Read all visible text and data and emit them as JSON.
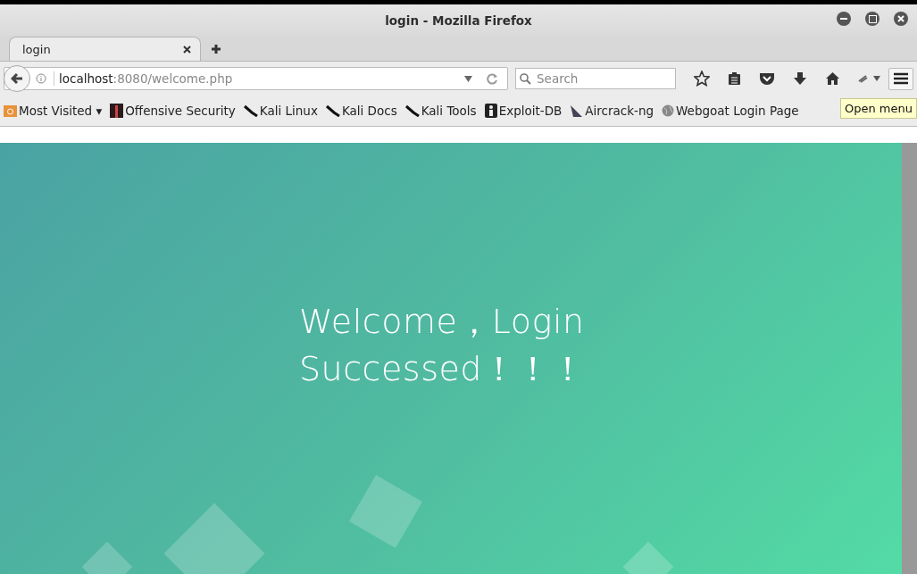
{
  "window": {
    "title": "login - Mozilla Firefox"
  },
  "tabs": [
    {
      "label": "login",
      "selected": true
    }
  ],
  "address_bar": {
    "host": "localhost",
    "path": ":8080/welcome.php"
  },
  "search": {
    "placeholder": "Search"
  },
  "bookmarks": [
    {
      "label": "Most Visited ▾",
      "kind": "folder"
    },
    {
      "label": "Offensive Security",
      "kind": "offsec"
    },
    {
      "label": "Kali Linux",
      "kind": "kali"
    },
    {
      "label": "Kali Docs",
      "kind": "kali"
    },
    {
      "label": "Kali Tools",
      "kind": "kali"
    },
    {
      "label": "Exploit-DB",
      "kind": "exploit"
    },
    {
      "label": "Aircrack-ng",
      "kind": "aircrack"
    },
    {
      "label": "Webgoat Login Page",
      "kind": "globe"
    }
  ],
  "tooltip": "Open menu",
  "page": {
    "heading": "Welcome，Login Successed！！！"
  }
}
